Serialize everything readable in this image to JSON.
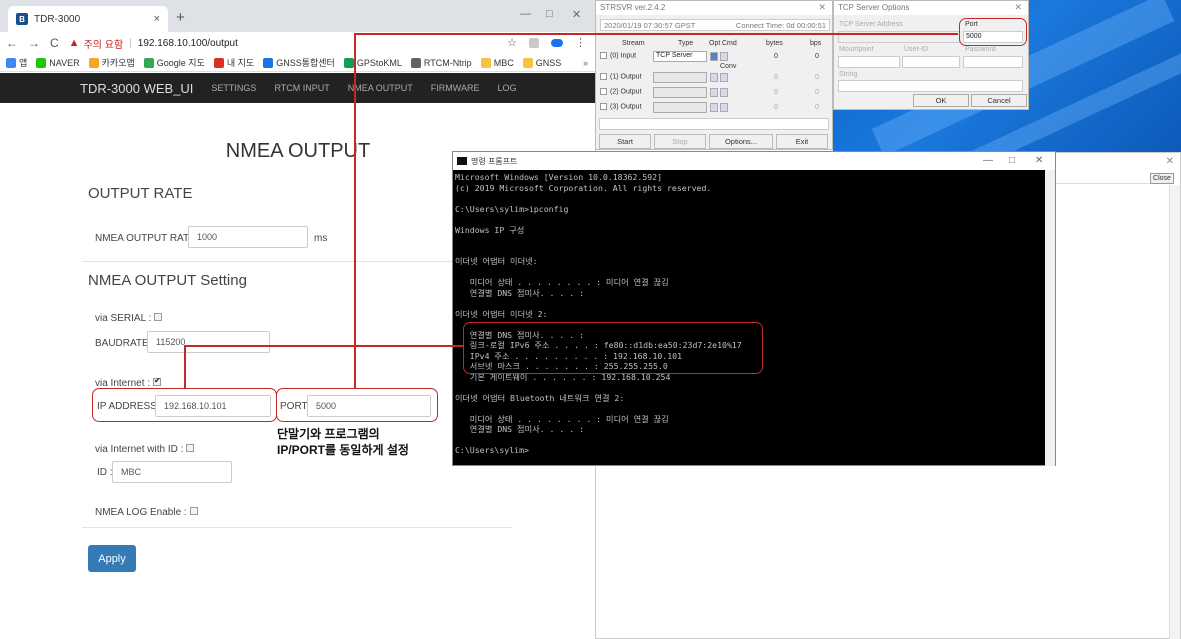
{
  "browser": {
    "tab_title": "TDR-3000",
    "tab_icon": "B",
    "tab_close": "×",
    "new_tab": "+",
    "win_min": "—",
    "win_max": "□",
    "win_close": "✕",
    "nav_back": "←",
    "nav_forward": "→",
    "nav_reload": "C",
    "security_icon": "▲",
    "security_text": "주의 요함",
    "address_sep": "|",
    "url": "192.168.10.100/output",
    "star": "☆",
    "menu_dots": "⋮",
    "bookmarks": [
      {
        "label": "앱",
        "color": "#4285f4",
        "icon": "grid-icon"
      },
      {
        "label": "NAVER",
        "color": "#1ec800",
        "icon": "naver-icon"
      },
      {
        "label": "카카오맵",
        "color": "#f5a623",
        "icon": "kakaomap-icon"
      },
      {
        "label": "Google 지도",
        "color": "#34a853",
        "icon": "google-maps-icon"
      },
      {
        "label": "내 지도",
        "color": "#d93025",
        "icon": "my-map-icon"
      },
      {
        "label": "GNSS통합센터",
        "color": "#1a73e8",
        "icon": "gnss-center-icon"
      },
      {
        "label": "GPStoKML",
        "color": "#0f9d58",
        "icon": "gpstokml-icon"
      },
      {
        "label": "RTCM-Ntrip",
        "color": "#5f6368",
        "icon": "rtcm-icon"
      },
      {
        "label": "MBC",
        "color": "#f6c343",
        "icon": "folder-icon"
      },
      {
        "label": "GNSS",
        "color": "#f6c343",
        "icon": "folder-icon"
      }
    ],
    "bookmarks_more": "»"
  },
  "app": {
    "brand": "TDR-3000 WEB_UI",
    "nav": [
      "SETTINGS",
      "RTCM INPUT",
      "NMEA OUTPUT",
      "FIRMWARE",
      "LOG"
    ],
    "page_title": "NMEA OUTPUT",
    "output_rate": {
      "section": "OUTPUT RATE",
      "label": "NMEA OUTPUT RATE :",
      "value": "1000",
      "unit": "ms"
    },
    "setting": {
      "section": "NMEA OUTPUT Setting",
      "via_serial": "via SERIAL :",
      "baudrate_label": "BAUDRATE :",
      "baudrate_value": "115200",
      "via_internet": "via Internet :",
      "ip_label": "IP ADDRESS :",
      "ip_value": "192.168.10.101",
      "port_label": "PORT :",
      "port_value": "5000",
      "via_internet_id": "via Internet with ID :",
      "id_label": "ID :",
      "id_value": "MBC",
      "log_enable": "NMEA LOG Enable :"
    },
    "apply": "Apply",
    "annotation": [
      "단말기와 프로그램의",
      "IP/PORT를 동일하게 설정"
    ]
  },
  "strsvr": {
    "title": "STRSVR ver.2.4.2",
    "time": "2020/01/19 07:30:57 GPST",
    "connect_label": "Connect Time:",
    "connect_value": "0d 00:00:51",
    "headers": [
      "Stream",
      "Type",
      "Opt",
      "Cmd",
      "bytes",
      "bps"
    ],
    "conv": "Conv",
    "input_label": "(0) Input",
    "input_type": "TCP Server",
    "outputs": [
      "(1) Output",
      "(2) Output",
      "(3) Output"
    ],
    "zero": "0",
    "buttons": [
      "Start",
      "Stop",
      "Options...",
      "Exit"
    ],
    "close": "✕"
  },
  "tcp": {
    "title": "TCP Server Options",
    "server_label": "TCP Server Address",
    "port_label": "Port",
    "port_value": "5000",
    "mountpoint_label": "Mountpoint",
    "userid_label": "User-ID",
    "password_label": "Password",
    "string_label": "String",
    "ok": "OK",
    "cancel": "Cancel",
    "close": "✕"
  },
  "rwin": {
    "close_btn": "Close",
    "close_x": "✕"
  },
  "cmd": {
    "title": "명령 프롬프트",
    "min": "—",
    "max": "□",
    "close": "✕",
    "lines": [
      "Microsoft Windows [Version 10.0.18362.592]",
      "(c) 2019 Microsoft Corporation. All rights reserved.",
      "",
      "C:\\Users\\sylim>ipconfig",
      "",
      "Windows IP 구성",
      "",
      "",
      "이더넷 어댑터 이더넷:",
      "",
      "   미디어 상태 . . . . . . . . : 미디어 연결 끊김",
      "   연결별 DNS 접미사. . . . :",
      "",
      "이더넷 어댑터 이더넷 2:",
      "",
      "   연결별 DNS 접미사. . . . :",
      "   링크-로컬 IPv6 주소 . . . . : fe80::d1db:ea50:23d7:2e10%17",
      "   IPv4 주소 . . . . . . . . . : 192.168.10.101",
      "   서브넷 마스크 . . . . . . . : 255.255.255.0",
      "   기본 게이트웨이 . . . . . . : 192.168.10.254",
      "",
      "이더넷 어댑터 Bluetooth 네트워크 연결 2:",
      "",
      "   미디어 상태 . . . . . . . . : 미디어 연결 끊김",
      "   연결별 DNS 접미사. . . . :",
      "",
      "C:\\Users\\sylim>"
    ]
  },
  "colors": {
    "annotation_red": "#c62828",
    "navbar": "#222222",
    "apply_blue": "#337ab7",
    "desktop_blue": "#0a66c8"
  }
}
